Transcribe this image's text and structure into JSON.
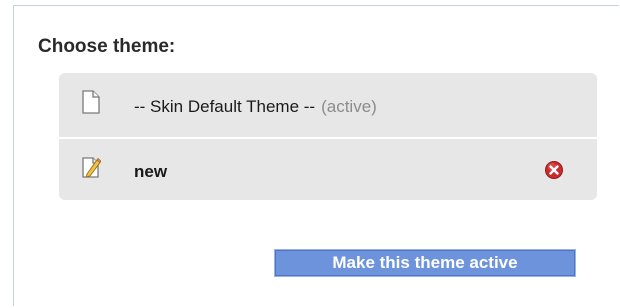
{
  "heading": "Choose theme:",
  "themes": [
    {
      "name": "-- Skin Default Theme --",
      "status": "(active)",
      "icon": "document-icon"
    },
    {
      "name": "new",
      "icon": "edit-document-icon",
      "delete_icon": "delete-icon"
    }
  ],
  "button": {
    "label": "Make this theme active"
  },
  "colors": {
    "list_background": "#e7e7e7",
    "button_background": "#6e93dd",
    "active_tag": "#8c8c8c",
    "delete_red": "#cc2b2b"
  }
}
